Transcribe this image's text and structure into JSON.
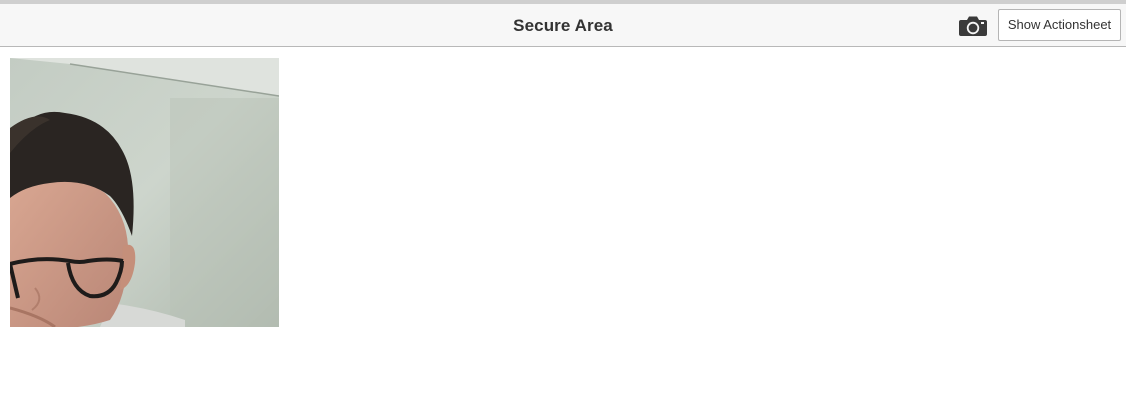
{
  "header": {
    "title": "Secure Area",
    "camera_icon": "camera-icon",
    "action_button_label": "Show Actionsheet"
  },
  "content": {
    "photo_subject": "captured-photo"
  },
  "colors": {
    "header_bg": "#f7f7f7",
    "header_border": "#b8b8b8",
    "title_text": "#333333",
    "icon": "#3a3a3a"
  }
}
